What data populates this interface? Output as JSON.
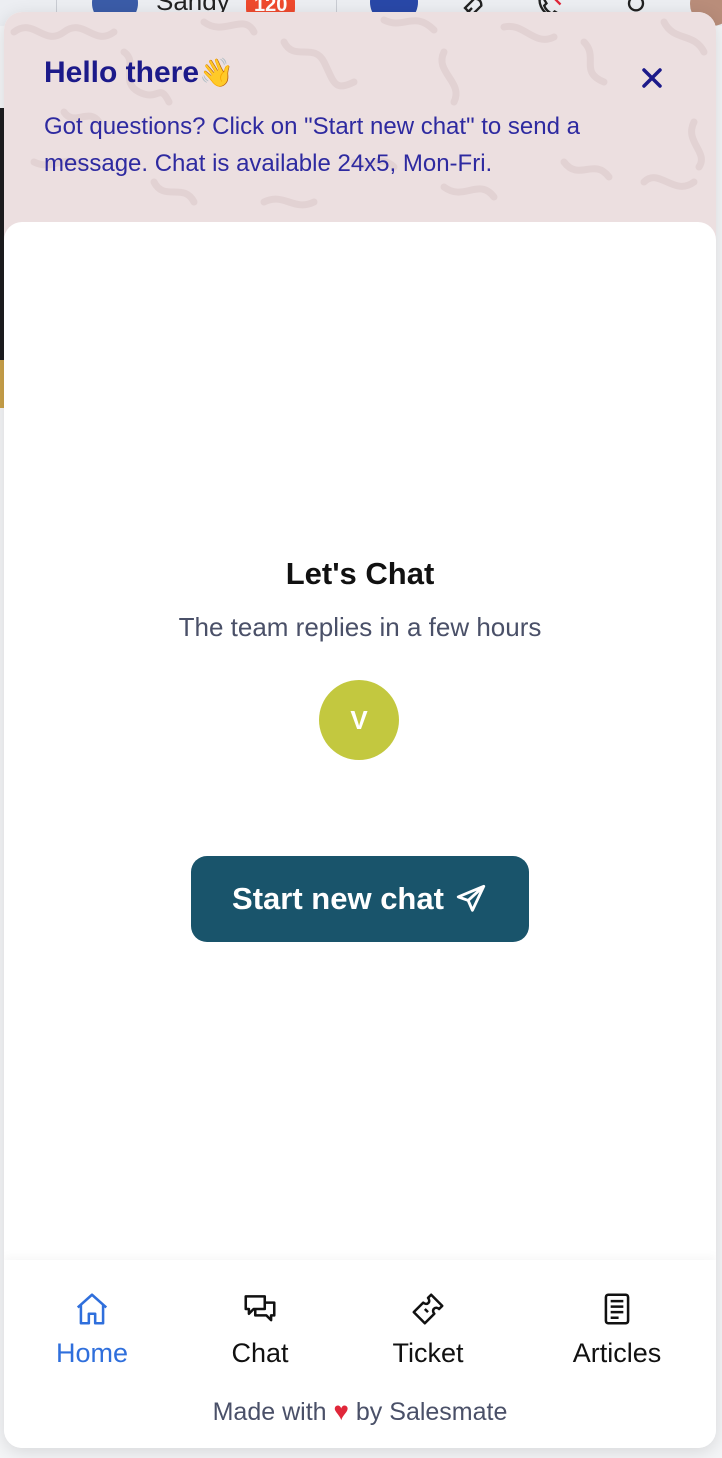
{
  "background": {
    "user_name": "Sandy",
    "notification_count": "120"
  },
  "header": {
    "title": "Hello there",
    "wave_emoji": "👋",
    "message": "Got questions? Click on \"Start new chat\" to send a message. Chat is available 24x5, Mon-Fri.",
    "close_icon": "close-icon"
  },
  "main": {
    "heading": "Let's Chat",
    "subheading": "The team replies in a few hours",
    "agent_initial": "V",
    "start_button_label": "Start new chat",
    "start_button_icon": "paper-plane-icon"
  },
  "nav": {
    "items": [
      {
        "label": "Home",
        "icon": "home-icon",
        "active": true
      },
      {
        "label": "Chat",
        "icon": "chat-bubbles-icon",
        "active": false
      },
      {
        "label": "Ticket",
        "icon": "ticket-icon",
        "active": false
      },
      {
        "label": "Articles",
        "icon": "articles-icon",
        "active": false
      }
    ]
  },
  "footer": {
    "made_with": "Made with",
    "heart": "♥",
    "by": "by",
    "brand": "Salesmate"
  },
  "colors": {
    "header_bg": "#ecdfe0",
    "header_text": "#1c1a8a",
    "primary_button": "#19546b",
    "agent_avatar": "#c3c83f",
    "active_nav": "#2f6fdc",
    "heart": "#e0273a",
    "badge": "#ef4a2e"
  }
}
